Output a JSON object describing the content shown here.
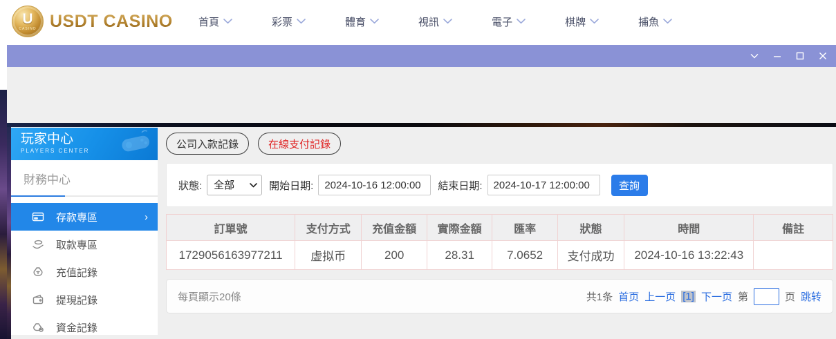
{
  "brand": {
    "name": "USDT CASINO",
    "logo_letter": "U",
    "logo_sub": "CASINO"
  },
  "nav": {
    "items": [
      {
        "label": "首頁"
      },
      {
        "label": "彩票"
      },
      {
        "label": "體育"
      },
      {
        "label": "視訊"
      },
      {
        "label": "電子"
      },
      {
        "label": "棋牌"
      },
      {
        "label": "捕魚"
      }
    ]
  },
  "window": {
    "controls": [
      "collapse-chevron",
      "minimize",
      "maximize",
      "close"
    ]
  },
  "sidebar": {
    "title": "玩家中心",
    "subtitle": "PLAYERS CENTER",
    "section": "財務中心",
    "items": [
      {
        "label": "存款專區",
        "active": true,
        "icon": "bank-card-icon"
      },
      {
        "label": "取款專區",
        "active": false,
        "icon": "hand-money-icon"
      },
      {
        "label": "充值記錄",
        "active": false,
        "icon": "money-bag-icon"
      },
      {
        "label": "提現記錄",
        "active": false,
        "icon": "wallet-icon"
      },
      {
        "label": "資金記錄",
        "active": false,
        "icon": "coin-bag-icon"
      }
    ],
    "active_chevron": "›"
  },
  "tabs": [
    {
      "label": "公司入款記錄",
      "active": false
    },
    {
      "label": "在線支付記錄",
      "active": true
    }
  ],
  "filters": {
    "status_label": "狀態:",
    "status_value": "全部",
    "start_label": "開始日期:",
    "start_value": "2024-10-16 12:00:00",
    "end_label": "結束日期:",
    "end_value": "2024-10-17 12:00:00",
    "search_label": "查詢"
  },
  "table": {
    "headers": [
      "訂單號",
      "支付方式",
      "充值金額",
      "實際金額",
      "匯率",
      "狀態",
      "時間",
      "備註"
    ],
    "rows": [
      [
        "1729056163977211",
        "虚拟币",
        "200",
        "28.31",
        "7.0652",
        "支付成功",
        "2024-10-16 13:22:43",
        ""
      ]
    ]
  },
  "pagination": {
    "page_size_text": "每頁顯示20條",
    "total_text": "共1条",
    "first": "首页",
    "prev": "上一页",
    "current": "[1]",
    "next": "下一页",
    "jump_pre": "第",
    "jump_post": "页",
    "jump_go": "跳转",
    "jump_value": ""
  },
  "colors": {
    "titlebar_purple": "#8a92d6",
    "sidebar_blue_top": "#2fa7f5",
    "sidebar_blue_bottom": "#0b79d4",
    "active_item_blue": "#2287e8",
    "accent_blue": "#2b7ce9",
    "link_blue": "#2a6de0",
    "tab_active_red": "#e02525",
    "brand_gold": "#b3832e",
    "table_border_pink": "#f0d2d2"
  }
}
